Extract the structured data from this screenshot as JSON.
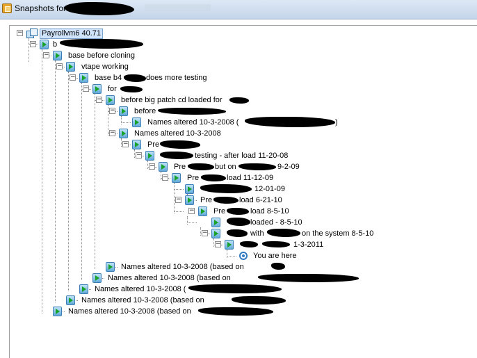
{
  "window": {
    "title": "Snapshots for",
    "icon": "snapshot-manager-icon"
  },
  "tree": {
    "nodes": [
      {
        "label": "Payrollvm6 40.71"
      },
      {
        "label": "b"
      },
      {
        "label": "base before cloning"
      },
      {
        "label": "vtape working"
      },
      {
        "label": "base b4",
        "suffix": "does more testing"
      },
      {
        "label": "for"
      },
      {
        "label": "before big patch cd loaded for"
      },
      {
        "label": "before"
      },
      {
        "label": "Names altered 10-3-2008 (",
        "suffix": ")"
      },
      {
        "label": "Names altered 10-3-2008"
      },
      {
        "label": "Pre"
      },
      {
        "label": "testing - after load 11-20-08"
      },
      {
        "label": "Pre",
        "middle": "but on",
        "suffix": "9-2-09"
      },
      {
        "label": "Pre",
        "suffix": "load 11-12-09"
      },
      {
        "label": "12-01-09"
      },
      {
        "label": "Pre",
        "suffix": "load 6-21-10"
      },
      {
        "label": "Pre",
        "suffix": "load 8-5-10"
      },
      {
        "label": "loaded - 8-5-10"
      },
      {
        "label": "with",
        "suffix": "on the system 8-5-10"
      },
      {
        "label": "1-3-2011"
      },
      {
        "label": "You are here"
      },
      {
        "label": "Names altered 10-3-2008 (based on"
      },
      {
        "label": "Names altered 10-3-2008 (based on"
      },
      {
        "label": "Names altered 10-3-2008 ("
      },
      {
        "label": "Names altered 10-3-2008 (based on"
      },
      {
        "label": "Names altered 10-3-2008 (based on"
      }
    ]
  },
  "colors": {
    "selection": "#cfe3fb",
    "snapshot_icon_play": "#17a32a",
    "you_are_here": "#2e7bc4"
  }
}
